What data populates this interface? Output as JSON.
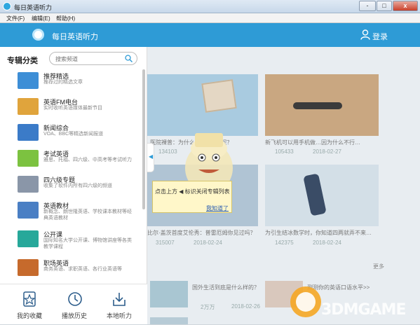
{
  "window": {
    "title": "每日英语听力",
    "controls": [
      "-",
      "□",
      "x"
    ]
  },
  "menu": [
    "文件(F)",
    "编辑(E)",
    "帮助(H)"
  ],
  "header": {
    "app_name": "每日英语听力",
    "login_label": "登录"
  },
  "sidebar": {
    "title": "专辑分类",
    "search_placeholder": "搜索频道",
    "categories": [
      {
        "name": "推荐精选",
        "desc": "推荐过的精选文章",
        "color": "#3d8ed6"
      },
      {
        "name": "英语FM电台",
        "desc": "实时收听英语媒体最新节目",
        "color": "#e0a43c"
      },
      {
        "name": "新闻综合",
        "desc": "VOA、BBC等精选新闻报道",
        "color": "#3b7bc8"
      },
      {
        "name": "考试英语",
        "desc": "雅思、托福、四六级、中高考等考试听力",
        "color": "#7cc240"
      },
      {
        "name": "四六级专题",
        "desc": "收集了软件内所有四六级的频道",
        "color": "#8a96a8"
      },
      {
        "name": "英语教材",
        "desc": "新概念、朗世隆英语、学校课本教材等经典英语教材",
        "color": "#4a7fc4"
      },
      {
        "name": "公开课",
        "desc": "国际知名大学公开课、博物馆讲座等各类教学课程",
        "color": "#27a89a"
      },
      {
        "name": "职场英语",
        "desc": "商务英语、求职英语、各行业英语等",
        "color": "#c66a2c"
      }
    ],
    "bottom_nav": [
      {
        "label": "我的收藏",
        "icon": "star-icon"
      },
      {
        "label": "播放历史",
        "icon": "clock-icon"
      },
      {
        "label": "本地听力",
        "icon": "download-icon"
      }
    ],
    "collapse_arrow": "◀"
  },
  "content": {
    "cards": [
      {
        "caption": "医院裸普：为什么2月有28天呢？",
        "views": "134103",
        "date": "",
        "color": "#6db6d9"
      },
      {
        "caption": "新飞机可以用手机做…因为什么不行…",
        "views": "105433",
        "date": "2018-02-27",
        "color": "#dba36a"
      },
      {
        "caption": "比尔·盖茨首度艾伦秀：普雷厄姆你见过吗？",
        "views": "315007",
        "date": "2018-02-24",
        "color": "#8fb0c7"
      },
      {
        "caption": "为引生结冰数学时，你知道四两就弄不来…",
        "views": "142375",
        "date": "2018-02-24",
        "color": "#b9cfdc"
      }
    ],
    "more_label": "更多",
    "list_items": [
      {
        "caption": "国外生活到底是什么样的？",
        "views": "2万万",
        "date": "2018-02-26"
      },
      {
        "caption": "测测你的英语口语水平>>",
        "views": "",
        "date": ""
      }
    ]
  },
  "tooltip": {
    "text": "点击上方 ◀ 标识关闭专辑列表",
    "link": "我知道了"
  },
  "watermark": {
    "text": "3DMGAME"
  }
}
